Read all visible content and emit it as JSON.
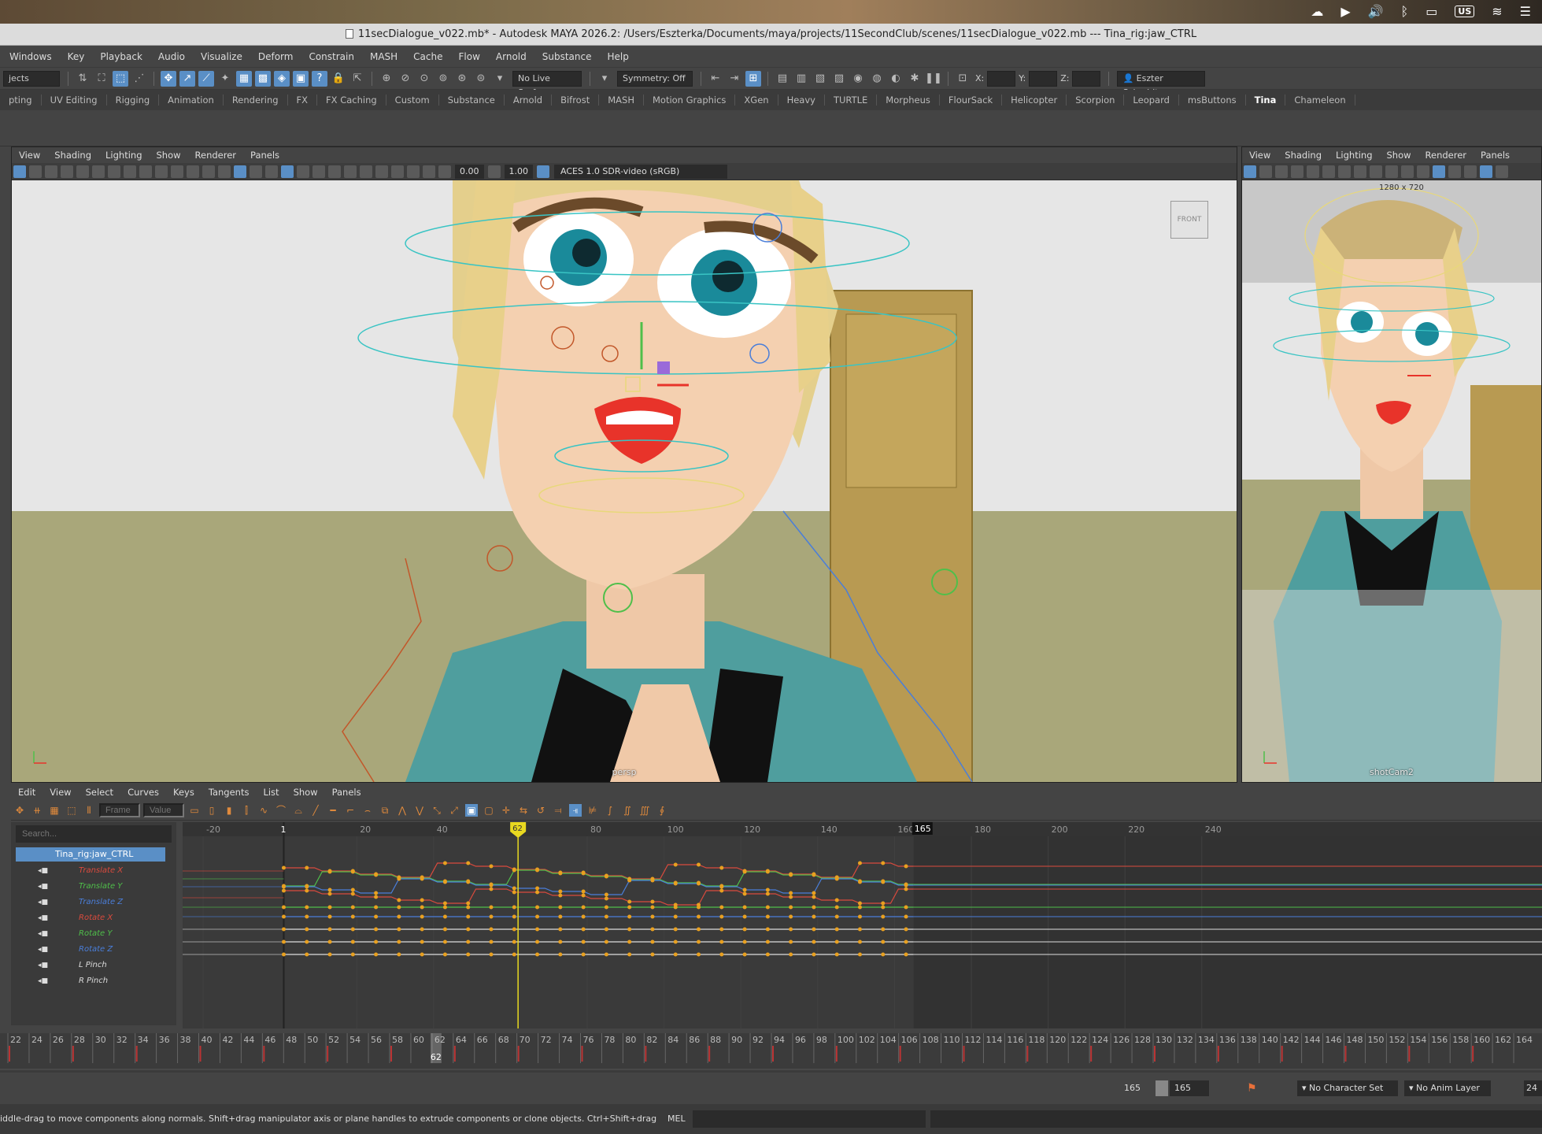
{
  "menubar": {
    "keyboard_layout": "US"
  },
  "title_bar": {
    "title": "11secDialogue_v022.mb* - Autodesk MAYA 2026.2: /Users/Eszterka/Documents/maya/projects/11SecondClub/scenes/11secDialogue_v022.mb   ---   Tina_rig:jaw_CTRL"
  },
  "main_menu": [
    "Windows",
    "Key",
    "Playback",
    "Audio",
    "Visualize",
    "Deform",
    "Constrain",
    "MASH",
    "Cache",
    "Flow",
    "Arnold",
    "Substance",
    "Help"
  ],
  "status_line": {
    "menu_set": "jects",
    "live_surface": "No Live Surface",
    "symmetry": "Symmetry: Off",
    "x_label": "X:",
    "y_label": "Y:",
    "z_label": "Z:",
    "user": "Eszter Schmidt"
  },
  "shelf_tabs": {
    "items": [
      "pting",
      "UV Editing",
      "Rigging",
      "Animation",
      "Rendering",
      "FX",
      "FX Caching",
      "Custom",
      "Substance",
      "Arnold",
      "Bifrost",
      "MASH",
      "Motion Graphics",
      "XGen",
      "Heavy",
      "TURTLE",
      "Morpheus",
      "FlourSack",
      "Helicopter",
      "Scorpion",
      "Leopard",
      "msButtons",
      "Tina",
      "Chameleon"
    ],
    "active": "Tina"
  },
  "viewport_menu": [
    "View",
    "Shading",
    "Lighting",
    "Show",
    "Renderer",
    "Panels"
  ],
  "viewport_left": {
    "exposure": "0.00",
    "gamma": "1.00",
    "color_space": "ACES 1.0 SDR-video (sRGB)",
    "view_cube": "FRONT",
    "camera": "persp"
  },
  "viewport_right": {
    "resolution_gate": "1280 x 720",
    "camera": "shotCam2"
  },
  "graph_editor": {
    "menu": [
      "Edit",
      "View",
      "Select",
      "Curves",
      "Keys",
      "Tangents",
      "List",
      "Show",
      "Panels"
    ],
    "frame_field_placeholder": "Frame",
    "value_field_placeholder": "Value",
    "search_placeholder": "Search...",
    "node": "Tina_rig:jaw_CTRL",
    "attributes": [
      {
        "name": "Translate X",
        "color": "#d94a3d"
      },
      {
        "name": "Translate Y",
        "color": "#4fbf4a"
      },
      {
        "name": "Translate Z",
        "color": "#4a7ed9"
      },
      {
        "name": "Rotate X",
        "color": "#d94a3d"
      },
      {
        "name": "Rotate Y",
        "color": "#4fbf4a"
      },
      {
        "name": "Rotate Z",
        "color": "#4a7ed9"
      },
      {
        "name": "L Pinch",
        "color": "#dddddd"
      },
      {
        "name": "R Pinch",
        "color": "#dddddd"
      }
    ],
    "ruler_ticks": [
      "-20",
      "20",
      "40",
      "80",
      "100",
      "120",
      "140",
      "160",
      "180",
      "200",
      "220",
      "240"
    ],
    "start_marker": "1",
    "current_frame": "62",
    "end_marker": "165"
  },
  "time_slider": {
    "ticks": [
      "22",
      "24",
      "26",
      "28",
      "30",
      "32",
      "34",
      "36",
      "38",
      "40",
      "42",
      "44",
      "46",
      "48",
      "50",
      "52",
      "54",
      "56",
      "58",
      "60",
      "62",
      "64",
      "66",
      "68",
      "70",
      "72",
      "74",
      "76",
      "78",
      "80",
      "82",
      "84",
      "86",
      "88",
      "90",
      "92",
      "94",
      "96",
      "98",
      "100",
      "102",
      "104",
      "106",
      "108",
      "110",
      "112",
      "114",
      "116",
      "118",
      "120",
      "122",
      "124",
      "126",
      "128",
      "130",
      "132",
      "134",
      "136",
      "138",
      "140",
      "142",
      "144",
      "146",
      "148",
      "150",
      "152",
      "154",
      "156",
      "158",
      "160",
      "162",
      "164"
    ],
    "current_frame": "62"
  },
  "range_slider": {
    "end_time": "165",
    "playback_end": "165",
    "character_set": "No Character Set",
    "anim_layer": "No Anim Layer",
    "fps": "24"
  },
  "help_line": {
    "message": "iddle-drag to move components along normals. Shift+drag manipulator axis or plane handles to extrude components or clone objects. Ctrl+Shift+drag to constrain move",
    "command_type": "MEL"
  },
  "colors": {
    "accent": "#5a8fc6",
    "current_time": "#e8d820",
    "key": "#e8a020"
  }
}
